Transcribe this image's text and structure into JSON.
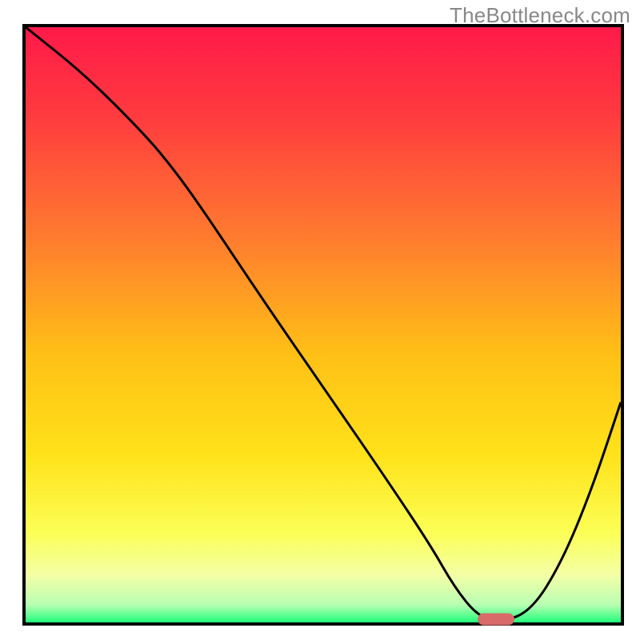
{
  "watermark": "TheBottleneck.com",
  "colors": {
    "border": "#000000",
    "curve": "#000000",
    "marker": "#d96a6a",
    "gradient_stops": [
      {
        "offset": 0.0,
        "color": "#ff1a49"
      },
      {
        "offset": 0.15,
        "color": "#ff3b3f"
      },
      {
        "offset": 0.35,
        "color": "#ff7a2f"
      },
      {
        "offset": 0.55,
        "color": "#ffc016"
      },
      {
        "offset": 0.72,
        "color": "#ffe21a"
      },
      {
        "offset": 0.85,
        "color": "#fbff56"
      },
      {
        "offset": 0.92,
        "color": "#f4ffa6"
      },
      {
        "offset": 0.97,
        "color": "#b9ffb3"
      },
      {
        "offset": 1.0,
        "color": "#21ff7a"
      }
    ]
  },
  "chart_data": {
    "type": "line",
    "title": "",
    "xlabel": "",
    "ylabel": "",
    "xlim": [
      0,
      100
    ],
    "ylim": [
      0,
      100
    ],
    "x": [
      0,
      10,
      20,
      25,
      30,
      40,
      50,
      60,
      68,
      72,
      76,
      80,
      85,
      90,
      95,
      100
    ],
    "values": [
      100,
      92,
      82,
      76,
      69,
      54,
      39.5,
      25,
      13,
      6,
      1,
      0,
      2,
      10,
      22,
      37
    ],
    "marker": {
      "x": 79,
      "y": 0.5
    },
    "notes": "Values read from vertical position of the black curve relative to the plot frame; 0 = bottom edge, 100 = top edge. Horizontal axis normalized 0–100 across the frame width. Marker is the red pill on the baseline."
  }
}
